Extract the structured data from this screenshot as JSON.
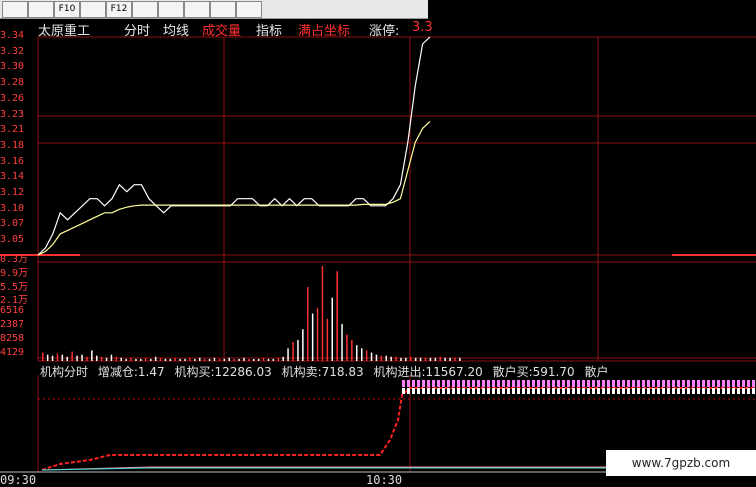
{
  "toolbar": {
    "buttons": [
      "",
      "",
      "F10",
      "",
      "F12",
      "",
      "",
      "",
      "",
      ""
    ]
  },
  "tabs": {
    "stock_name": "太原重工",
    "intraday": "分时",
    "avg_line": "均线",
    "volume": "成交量",
    "indicator": "指标",
    "full_scale": "满占坐标",
    "limit_up": "涨停:",
    "limit_up_value": "3.3"
  },
  "price_axis": {
    "labels": [
      "3.34",
      "3.32",
      "3.30",
      "3.28",
      "3.26",
      "3.23",
      "3.21",
      "3.18",
      "3.16",
      "3.14",
      "3.12",
      "3.10",
      "3.07",
      "3.05"
    ]
  },
  "volume_axis": {
    "labels": [
      "0.3万",
      "9.9万",
      "5.5万",
      "2.1万",
      "6516",
      "2387",
      "8258",
      "4129"
    ]
  },
  "stats": {
    "label_1": "机构分时",
    "label_2": "增减仓:1.47",
    "label_3": "机构买:12286.03",
    "label_4": "机构卖:718.83",
    "label_5": "机构进出:11567.20",
    "label_6": "散户买:591.70",
    "label_7": "散户"
  },
  "time_axis": {
    "start": "09:30",
    "mid": "10:30"
  },
  "watermark": "www.7gpzb.com",
  "colors": {
    "grid": "#8b1010",
    "price": "#ffffff",
    "avg": "#ffff99",
    "up": "#ff3030",
    "down": "#ffffff"
  },
  "chart_data": {
    "type": "line",
    "price_ylim": [
      3.04,
      3.35
    ],
    "price_series": [
      {
        "values": [
          3.04,
          3.05,
          3.07,
          3.1,
          3.09,
          3.1,
          3.11,
          3.12,
          3.12,
          3.11,
          3.12,
          3.14,
          3.13,
          3.14,
          3.14,
          3.12,
          3.11,
          3.1,
          3.11,
          3.11,
          3.11,
          3.11,
          3.11,
          3.11,
          3.11,
          3.11,
          3.11,
          3.12,
          3.12,
          3.12,
          3.11,
          3.11,
          3.12,
          3.11,
          3.12,
          3.11,
          3.12,
          3.12,
          3.11,
          3.11,
          3.11,
          3.11,
          3.11,
          3.12,
          3.12,
          3.11,
          3.11,
          3.11,
          3.12,
          3.14,
          3.2,
          3.28,
          3.34,
          3.36
        ]
      },
      {
        "values": [
          3.04,
          3.045,
          3.055,
          3.07,
          3.075,
          3.08,
          3.085,
          3.09,
          3.095,
          3.1,
          3.1,
          3.105,
          3.108,
          3.11,
          3.111,
          3.111,
          3.111,
          3.111,
          3.111,
          3.111,
          3.111,
          3.111,
          3.111,
          3.111,
          3.111,
          3.111,
          3.111,
          3.111,
          3.111,
          3.111,
          3.111,
          3.111,
          3.111,
          3.111,
          3.111,
          3.111,
          3.111,
          3.111,
          3.111,
          3.111,
          3.111,
          3.111,
          3.111,
          3.111,
          3.112,
          3.112,
          3.112,
          3.112,
          3.115,
          3.12,
          3.16,
          3.2,
          3.22,
          3.23
        ]
      }
    ],
    "volume_bars": [
      8,
      6,
      5,
      7,
      6,
      4,
      9,
      5,
      6,
      4,
      10,
      5,
      4,
      3,
      6,
      4,
      3,
      2,
      3,
      2,
      2,
      3,
      2,
      4,
      3,
      2,
      2,
      3,
      2,
      2,
      3,
      2,
      3,
      2,
      2,
      3,
      2,
      2,
      3,
      2,
      2,
      3,
      2,
      2,
      2,
      3,
      2,
      2,
      3,
      4,
      12,
      18,
      20,
      30,
      70,
      45,
      50,
      90,
      40,
      60,
      85,
      35,
      25,
      20,
      15,
      12,
      10,
      8,
      6,
      5,
      5,
      4,
      4,
      3,
      3,
      4,
      3,
      3,
      3,
      3,
      3,
      4,
      3,
      3,
      3,
      3
    ]
  }
}
